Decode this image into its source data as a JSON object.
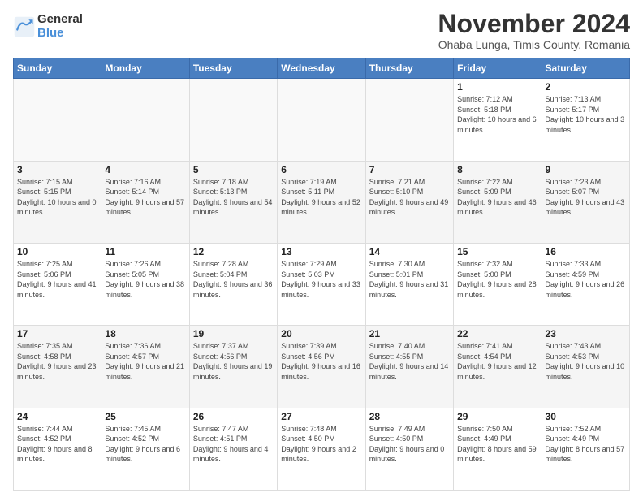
{
  "logo": {
    "general": "General",
    "blue": "Blue"
  },
  "title": "November 2024",
  "subtitle": "Ohaba Lunga, Timis County, Romania",
  "headers": [
    "Sunday",
    "Monday",
    "Tuesday",
    "Wednesday",
    "Thursday",
    "Friday",
    "Saturday"
  ],
  "rows": [
    [
      {
        "day": "",
        "info": ""
      },
      {
        "day": "",
        "info": ""
      },
      {
        "day": "",
        "info": ""
      },
      {
        "day": "",
        "info": ""
      },
      {
        "day": "",
        "info": ""
      },
      {
        "day": "1",
        "info": "Sunrise: 7:12 AM\nSunset: 5:18 PM\nDaylight: 10 hours and 6 minutes."
      },
      {
        "day": "2",
        "info": "Sunrise: 7:13 AM\nSunset: 5:17 PM\nDaylight: 10 hours and 3 minutes."
      }
    ],
    [
      {
        "day": "3",
        "info": "Sunrise: 7:15 AM\nSunset: 5:15 PM\nDaylight: 10 hours and 0 minutes."
      },
      {
        "day": "4",
        "info": "Sunrise: 7:16 AM\nSunset: 5:14 PM\nDaylight: 9 hours and 57 minutes."
      },
      {
        "day": "5",
        "info": "Sunrise: 7:18 AM\nSunset: 5:13 PM\nDaylight: 9 hours and 54 minutes."
      },
      {
        "day": "6",
        "info": "Sunrise: 7:19 AM\nSunset: 5:11 PM\nDaylight: 9 hours and 52 minutes."
      },
      {
        "day": "7",
        "info": "Sunrise: 7:21 AM\nSunset: 5:10 PM\nDaylight: 9 hours and 49 minutes."
      },
      {
        "day": "8",
        "info": "Sunrise: 7:22 AM\nSunset: 5:09 PM\nDaylight: 9 hours and 46 minutes."
      },
      {
        "day": "9",
        "info": "Sunrise: 7:23 AM\nSunset: 5:07 PM\nDaylight: 9 hours and 43 minutes."
      }
    ],
    [
      {
        "day": "10",
        "info": "Sunrise: 7:25 AM\nSunset: 5:06 PM\nDaylight: 9 hours and 41 minutes."
      },
      {
        "day": "11",
        "info": "Sunrise: 7:26 AM\nSunset: 5:05 PM\nDaylight: 9 hours and 38 minutes."
      },
      {
        "day": "12",
        "info": "Sunrise: 7:28 AM\nSunset: 5:04 PM\nDaylight: 9 hours and 36 minutes."
      },
      {
        "day": "13",
        "info": "Sunrise: 7:29 AM\nSunset: 5:03 PM\nDaylight: 9 hours and 33 minutes."
      },
      {
        "day": "14",
        "info": "Sunrise: 7:30 AM\nSunset: 5:01 PM\nDaylight: 9 hours and 31 minutes."
      },
      {
        "day": "15",
        "info": "Sunrise: 7:32 AM\nSunset: 5:00 PM\nDaylight: 9 hours and 28 minutes."
      },
      {
        "day": "16",
        "info": "Sunrise: 7:33 AM\nSunset: 4:59 PM\nDaylight: 9 hours and 26 minutes."
      }
    ],
    [
      {
        "day": "17",
        "info": "Sunrise: 7:35 AM\nSunset: 4:58 PM\nDaylight: 9 hours and 23 minutes."
      },
      {
        "day": "18",
        "info": "Sunrise: 7:36 AM\nSunset: 4:57 PM\nDaylight: 9 hours and 21 minutes."
      },
      {
        "day": "19",
        "info": "Sunrise: 7:37 AM\nSunset: 4:56 PM\nDaylight: 9 hours and 19 minutes."
      },
      {
        "day": "20",
        "info": "Sunrise: 7:39 AM\nSunset: 4:56 PM\nDaylight: 9 hours and 16 minutes."
      },
      {
        "day": "21",
        "info": "Sunrise: 7:40 AM\nSunset: 4:55 PM\nDaylight: 9 hours and 14 minutes."
      },
      {
        "day": "22",
        "info": "Sunrise: 7:41 AM\nSunset: 4:54 PM\nDaylight: 9 hours and 12 minutes."
      },
      {
        "day": "23",
        "info": "Sunrise: 7:43 AM\nSunset: 4:53 PM\nDaylight: 9 hours and 10 minutes."
      }
    ],
    [
      {
        "day": "24",
        "info": "Sunrise: 7:44 AM\nSunset: 4:52 PM\nDaylight: 9 hours and 8 minutes."
      },
      {
        "day": "25",
        "info": "Sunrise: 7:45 AM\nSunset: 4:52 PM\nDaylight: 9 hours and 6 minutes."
      },
      {
        "day": "26",
        "info": "Sunrise: 7:47 AM\nSunset: 4:51 PM\nDaylight: 9 hours and 4 minutes."
      },
      {
        "day": "27",
        "info": "Sunrise: 7:48 AM\nSunset: 4:50 PM\nDaylight: 9 hours and 2 minutes."
      },
      {
        "day": "28",
        "info": "Sunrise: 7:49 AM\nSunset: 4:50 PM\nDaylight: 9 hours and 0 minutes."
      },
      {
        "day": "29",
        "info": "Sunrise: 7:50 AM\nSunset: 4:49 PM\nDaylight: 8 hours and 59 minutes."
      },
      {
        "day": "30",
        "info": "Sunrise: 7:52 AM\nSunset: 4:49 PM\nDaylight: 8 hours and 57 minutes."
      }
    ]
  ]
}
